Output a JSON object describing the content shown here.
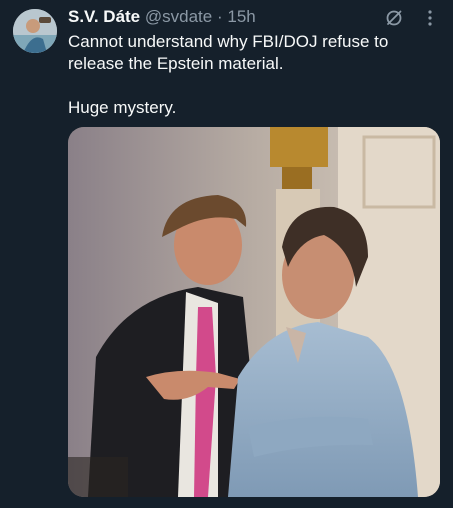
{
  "tweet": {
    "display_name": "S.V. Dáte",
    "handle": "@svdate",
    "separator": "·",
    "time": "15h",
    "text_lines": [
      "Cannot understand why FBI/DOJ refuse to release the Epstein material.",
      "Huge mystery."
    ],
    "icons": {
      "grok": "grok-icon",
      "more": "more-icon",
      "avatar": "avatar-icon"
    }
  },
  "colors": {
    "background": "#15202b",
    "primary_text": "#f7f9f9",
    "secondary_text": "#8b98a5"
  }
}
